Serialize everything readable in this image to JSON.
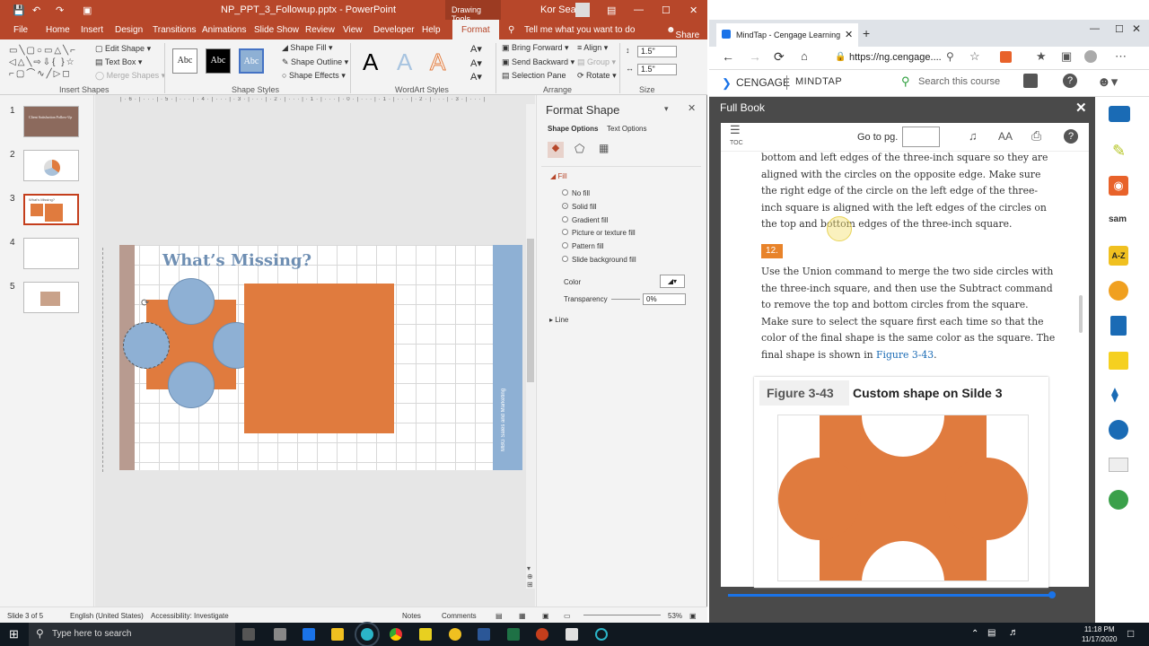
{
  "ppt": {
    "file_title": "NP_PPT_3_Followup.pptx - PowerPoint",
    "context_tab": "Drawing Tools",
    "user": "Kor Sean",
    "menu": [
      "File",
      "Home",
      "Insert",
      "Design",
      "Transitions",
      "Animations",
      "Slide Show",
      "Review",
      "View",
      "Developer",
      "Help",
      "Format"
    ],
    "tell_me": "Tell me what you want to do",
    "share": "Share",
    "ribbon": {
      "edit_shape": "Edit Shape",
      "text_box": "Text Box",
      "merge_shapes": "Merge Shapes",
      "insert_shapes": "Insert Shapes",
      "style_abc": "Abc",
      "shape_fill": "Shape Fill",
      "shape_outline": "Shape Outline",
      "shape_effects": "Shape Effects",
      "shape_styles": "Shape Styles",
      "wordart_a": "A",
      "wordart_styles": "WordArt Styles",
      "bring_forward": "Bring Forward",
      "send_backward": "Send Backward",
      "selection_pane": "Selection Pane",
      "align": "Align",
      "group": "Group",
      "rotate": "Rotate",
      "arrange": "Arrange",
      "height": "1.5\"",
      "width": "1.5\"",
      "size": "Size"
    },
    "thumbs": [
      {
        "num": "1",
        "text": "Client Satisfaction Follow-Up"
      },
      {
        "num": "2",
        "text": ""
      },
      {
        "num": "3",
        "text": "What's Missing?"
      },
      {
        "num": "4",
        "text": ""
      },
      {
        "num": "5",
        "text": ""
      }
    ],
    "slide": {
      "title": "What’s Missing?",
      "side_text": "MBG Sales and Marketing"
    },
    "pane": {
      "title": "Format Shape",
      "tab_shape": "Shape Options",
      "tab_text": "Text Options",
      "fill": "Fill",
      "options": [
        "No fill",
        "Solid fill",
        "Gradient fill",
        "Picture or texture fill",
        "Pattern fill",
        "Slide background fill"
      ],
      "selected_option": "Solid fill",
      "color": "Color",
      "transparency": "Transparency",
      "transparency_value": "0%",
      "line": "Line"
    },
    "status": {
      "slide": "Slide 3 of 5",
      "language": "English (United States)",
      "accessibility": "Accessibility: Investigate",
      "notes": "Notes",
      "comments": "Comments",
      "zoom": "53%"
    }
  },
  "browser": {
    "tab_title": "MindTap - Cengage Learning",
    "url": "https://ng.cengage....",
    "brand": "CENGAGE",
    "brand2": "MINDTAP",
    "search_placeholder": "Search this course",
    "full_book": "Full Book",
    "toc": "TOC",
    "goto": "Go to pg.",
    "text_size": "AA",
    "para1": "bottom and left edges of the three-inch square so they are aligned with the circles on the opposite edge. Make sure the right edge of the circle on the left edge of the three-inch square is aligned with the left edges of the circles on the top and bottom edges of the three-inch square.",
    "step": "12.",
    "para2_pre": "Use the Union command to merge the two side circles with the three-inch square, and then use the Subtract command to remove the top and bottom circles from the square. Make sure to select the square first each time so that the color of the final shape is the same color as the square. The final shape is shown in ",
    "para2_link": "Figure 3-43",
    "para2_post": ".",
    "fig_num": "Figure 3-43",
    "fig_caption": "Custom shape on Silde 3"
  },
  "taskbar": {
    "search_placeholder": "Type here to search",
    "time": "11:18 PM",
    "date": "11/17/2020"
  },
  "colors": {
    "ppt_red": "#b7472a",
    "shape_orange": "#e07b3e",
    "circle_blue": "#8eb0d4",
    "accent_blue": "#1a73e8"
  }
}
